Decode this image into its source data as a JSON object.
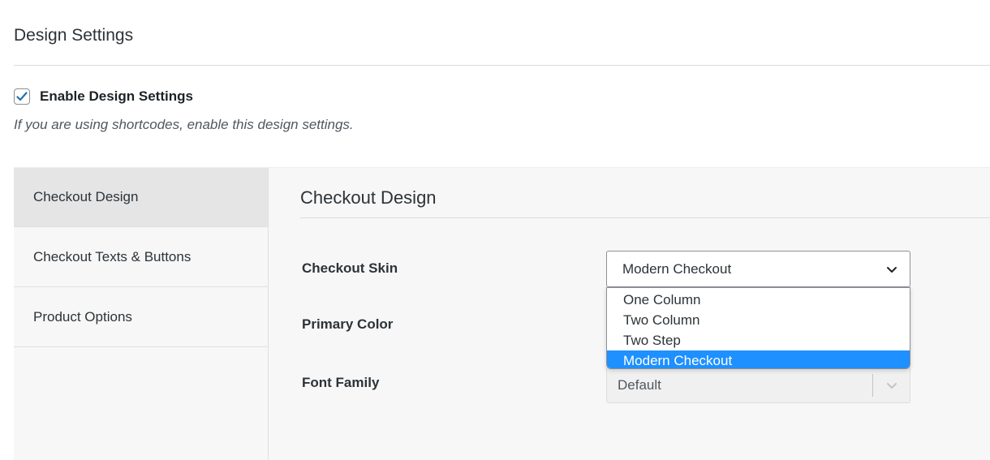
{
  "page": {
    "title": "Design Settings"
  },
  "enable": {
    "checked": true,
    "label": "Enable Design Settings",
    "hint": "If you are using shortcodes, enable this design settings."
  },
  "sidebar": {
    "items": [
      {
        "label": "Checkout Design",
        "active": true
      },
      {
        "label": "Checkout Texts & Buttons",
        "active": false
      },
      {
        "label": "Product Options",
        "active": false
      }
    ]
  },
  "content": {
    "section_title": "Checkout Design",
    "fields": {
      "checkout_skin": {
        "label": "Checkout Skin",
        "value": "Modern Checkout",
        "options": [
          "One Column",
          "Two Column",
          "Two Step",
          "Modern Checkout"
        ],
        "selected_index": 3
      },
      "primary_color": {
        "label": "Primary Color"
      },
      "font_family": {
        "label": "Font Family",
        "value": "Default"
      }
    }
  },
  "colors": {
    "checkbox_check": "#2271b1",
    "selected_option_bg": "#1e90ff",
    "panel_bg": "#f7f7f7",
    "active_tab_bg": "#e5e5e5"
  },
  "icons": {
    "checkbox": "checkmark-icon",
    "select_chevron": "chevron-down-icon"
  }
}
